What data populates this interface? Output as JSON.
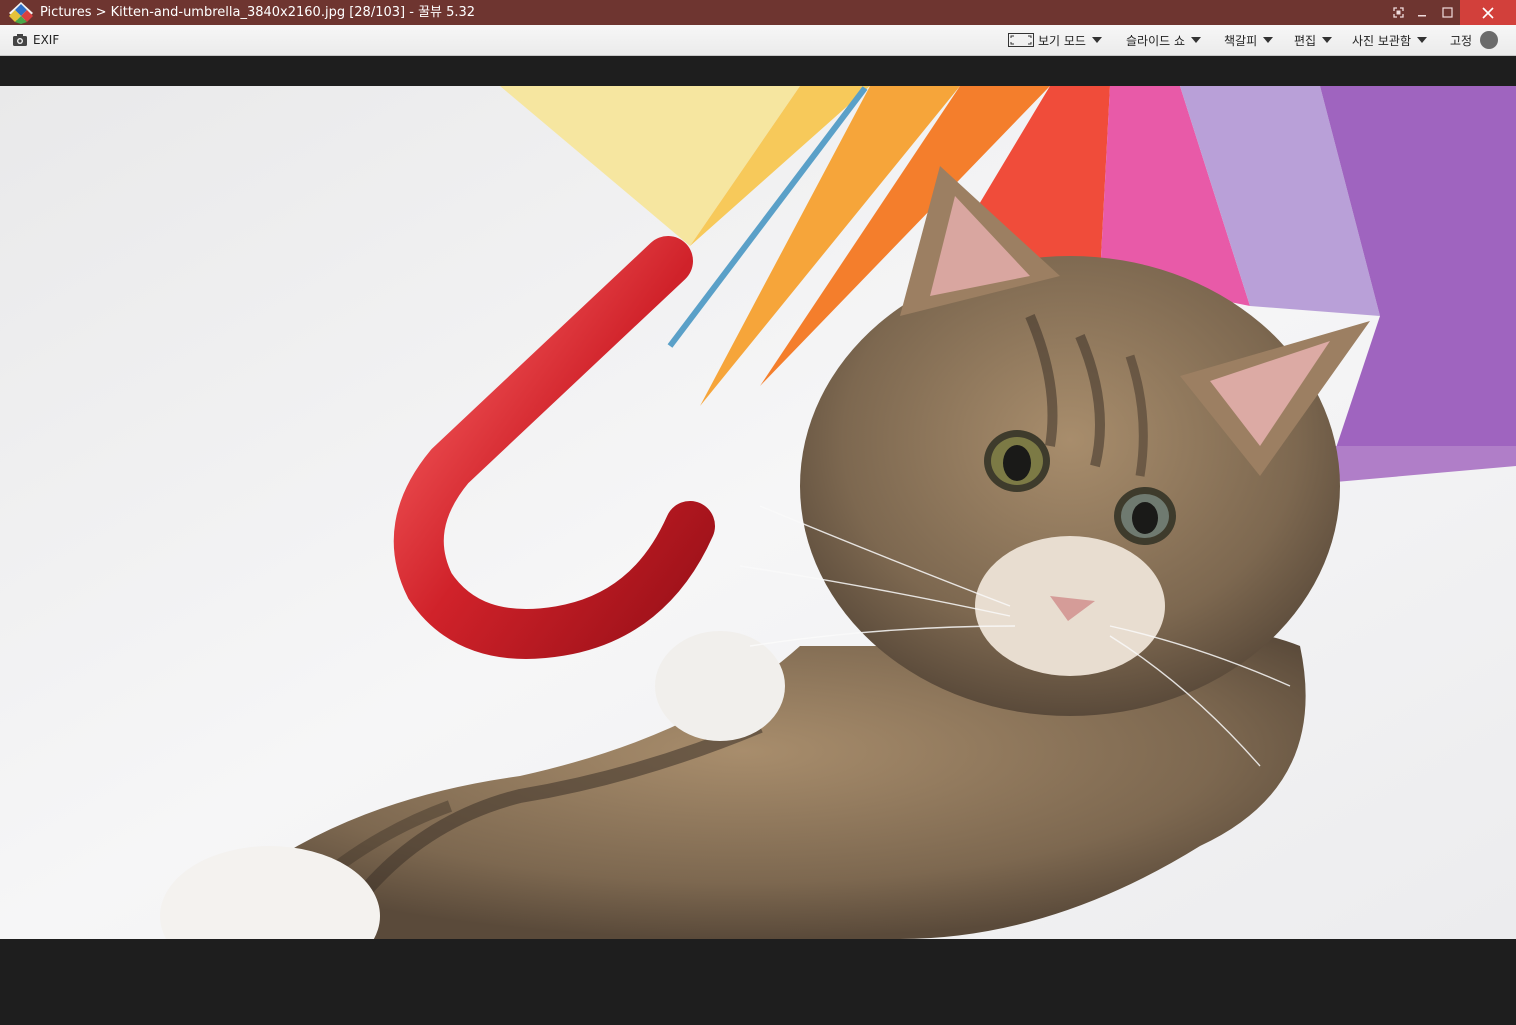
{
  "window": {
    "breadcrumb_root": "Pictures",
    "separator": " > ",
    "filename": "Kitten-and-umbrella_3840x2160.jpg",
    "position": "[28/103]",
    "dash": " - ",
    "app_name": "꿀뷰 5.32"
  },
  "toolbar": {
    "exif_label": "EXIF",
    "view_mode_label": "보기 모드",
    "slideshow_label": "슬라이드 쇼",
    "bookmark_label": "책갈피",
    "edit_label": "편집",
    "archive_label": "사진 보관함",
    "pin_label": "고정"
  },
  "image": {
    "description": "Kitten-and-umbrella_3840x2160.jpg"
  },
  "colors": {
    "titlebar": "#6e3530",
    "close_button": "#d2403b",
    "viewer_background": "#1e1e1e"
  }
}
